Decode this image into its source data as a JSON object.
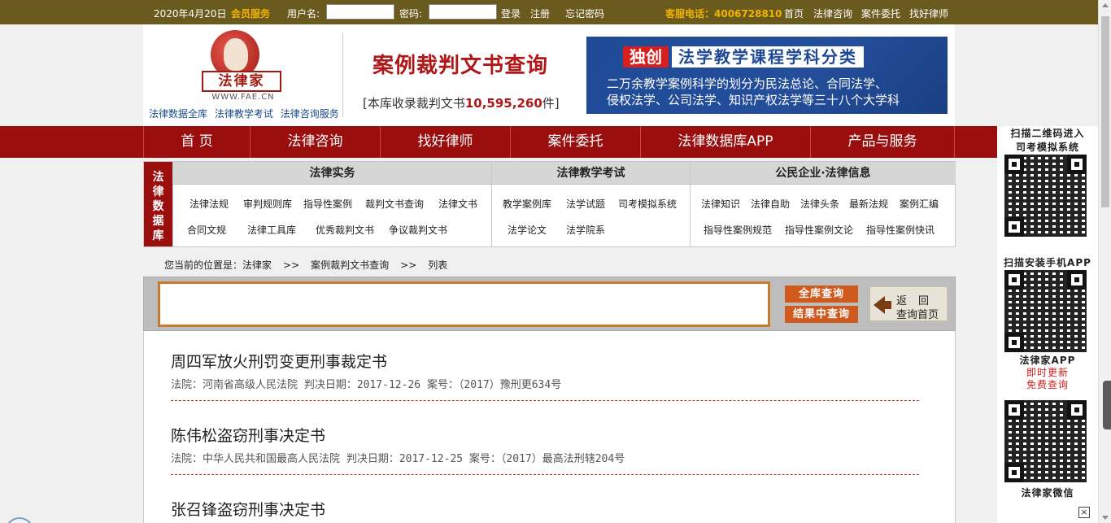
{
  "topbar": {
    "date": "2020年4月20日",
    "member": "会员服务",
    "username_label": "用户名:",
    "password_label": "密码:",
    "login": "登录",
    "register": "注册",
    "forgot": "忘记密码",
    "hotline": "客服电话：4006728810",
    "links": [
      "首页",
      "法律咨询",
      "案件委托",
      "找好律师"
    ]
  },
  "header": {
    "logo_text": "法律家",
    "logo_url": "WWW.FAE.CN",
    "logo_links": [
      "法律数据全库",
      "法律教学考试",
      "法律咨询服务"
    ],
    "title": "案例裁判文书查询",
    "subtitle_prefix": "[本库收录裁判文书",
    "subtitle_count": "10,595,260",
    "subtitle_suffix": "件]"
  },
  "banner": {
    "badge": "独创",
    "headline": "法学教学课程学科分类",
    "line1": "二万余教学案例科学的划分为民法总论、合同法学、",
    "line2": "侵权法学、公司法学、知识产权法学等三十八个大学科"
  },
  "mainnav": [
    "首 页",
    "法律咨询",
    "找好律师",
    "案件委托",
    "法律数据库APP",
    "产品与服务"
  ],
  "dbmenu": {
    "label": [
      "法",
      "律",
      "数",
      "据",
      "库"
    ],
    "columns": [
      {
        "title": "法律实务",
        "links": [
          "法律法规",
          "审判规则库",
          "指导性案例",
          "裁判文书查询",
          "法律文书",
          "合同文规",
          "法律工具库",
          "优秀裁判文书",
          "争议裁判文书"
        ]
      },
      {
        "title": "法律教学考试",
        "links": [
          "教学案例库",
          "法学试题",
          "司考模拟系统",
          "法学论文",
          "法学院系"
        ]
      },
      {
        "title": "公民企业·法律信息",
        "links": [
          "法律知识",
          "法律自助",
          "法律头条",
          "最新法规",
          "案例汇编",
          "指导性案例规范",
          "指导性案例文论",
          "指导性案例快讯"
        ]
      }
    ]
  },
  "breadcrumb": [
    "您当前的位置是：法律家",
    ">>",
    "案例裁判文书查询",
    ">>",
    "列表"
  ],
  "search": {
    "value": "",
    "btn_all": "全库查询",
    "btn_within": "结果中查询",
    "back_line1": "返回",
    "back_line2": "查询首页"
  },
  "results": [
    {
      "title": "周四军放火刑罚变更刑事裁定书",
      "meta": "法院：河南省高级人民法院 判决日期：2017-12-26 案号：（2017）豫刑更634号"
    },
    {
      "title": "陈伟松盗窃刑事决定书",
      "meta": "法院：中华人民共和国最高人民法院 判决日期：2017-12-25 案号：（2017）最高法刑辖204号"
    },
    {
      "title": "张召锋盗窃刑事决定书",
      "meta": ""
    }
  ],
  "sidebar": {
    "qr1_caption1": "扫描二维码进入",
    "qr1_caption2": "司考模拟系统",
    "qr2_caption": "扫描安装手机APP",
    "qr2_name": "法律家APP",
    "qr2_red1": "即时更新",
    "qr2_red2": "免费查询",
    "qr3_caption": "法律家微信"
  },
  "colors": {
    "topbar": "#6b5a1e",
    "nav_red": "#9b0e0e",
    "accent_orange": "#d0591e",
    "title_red": "#b01818"
  }
}
